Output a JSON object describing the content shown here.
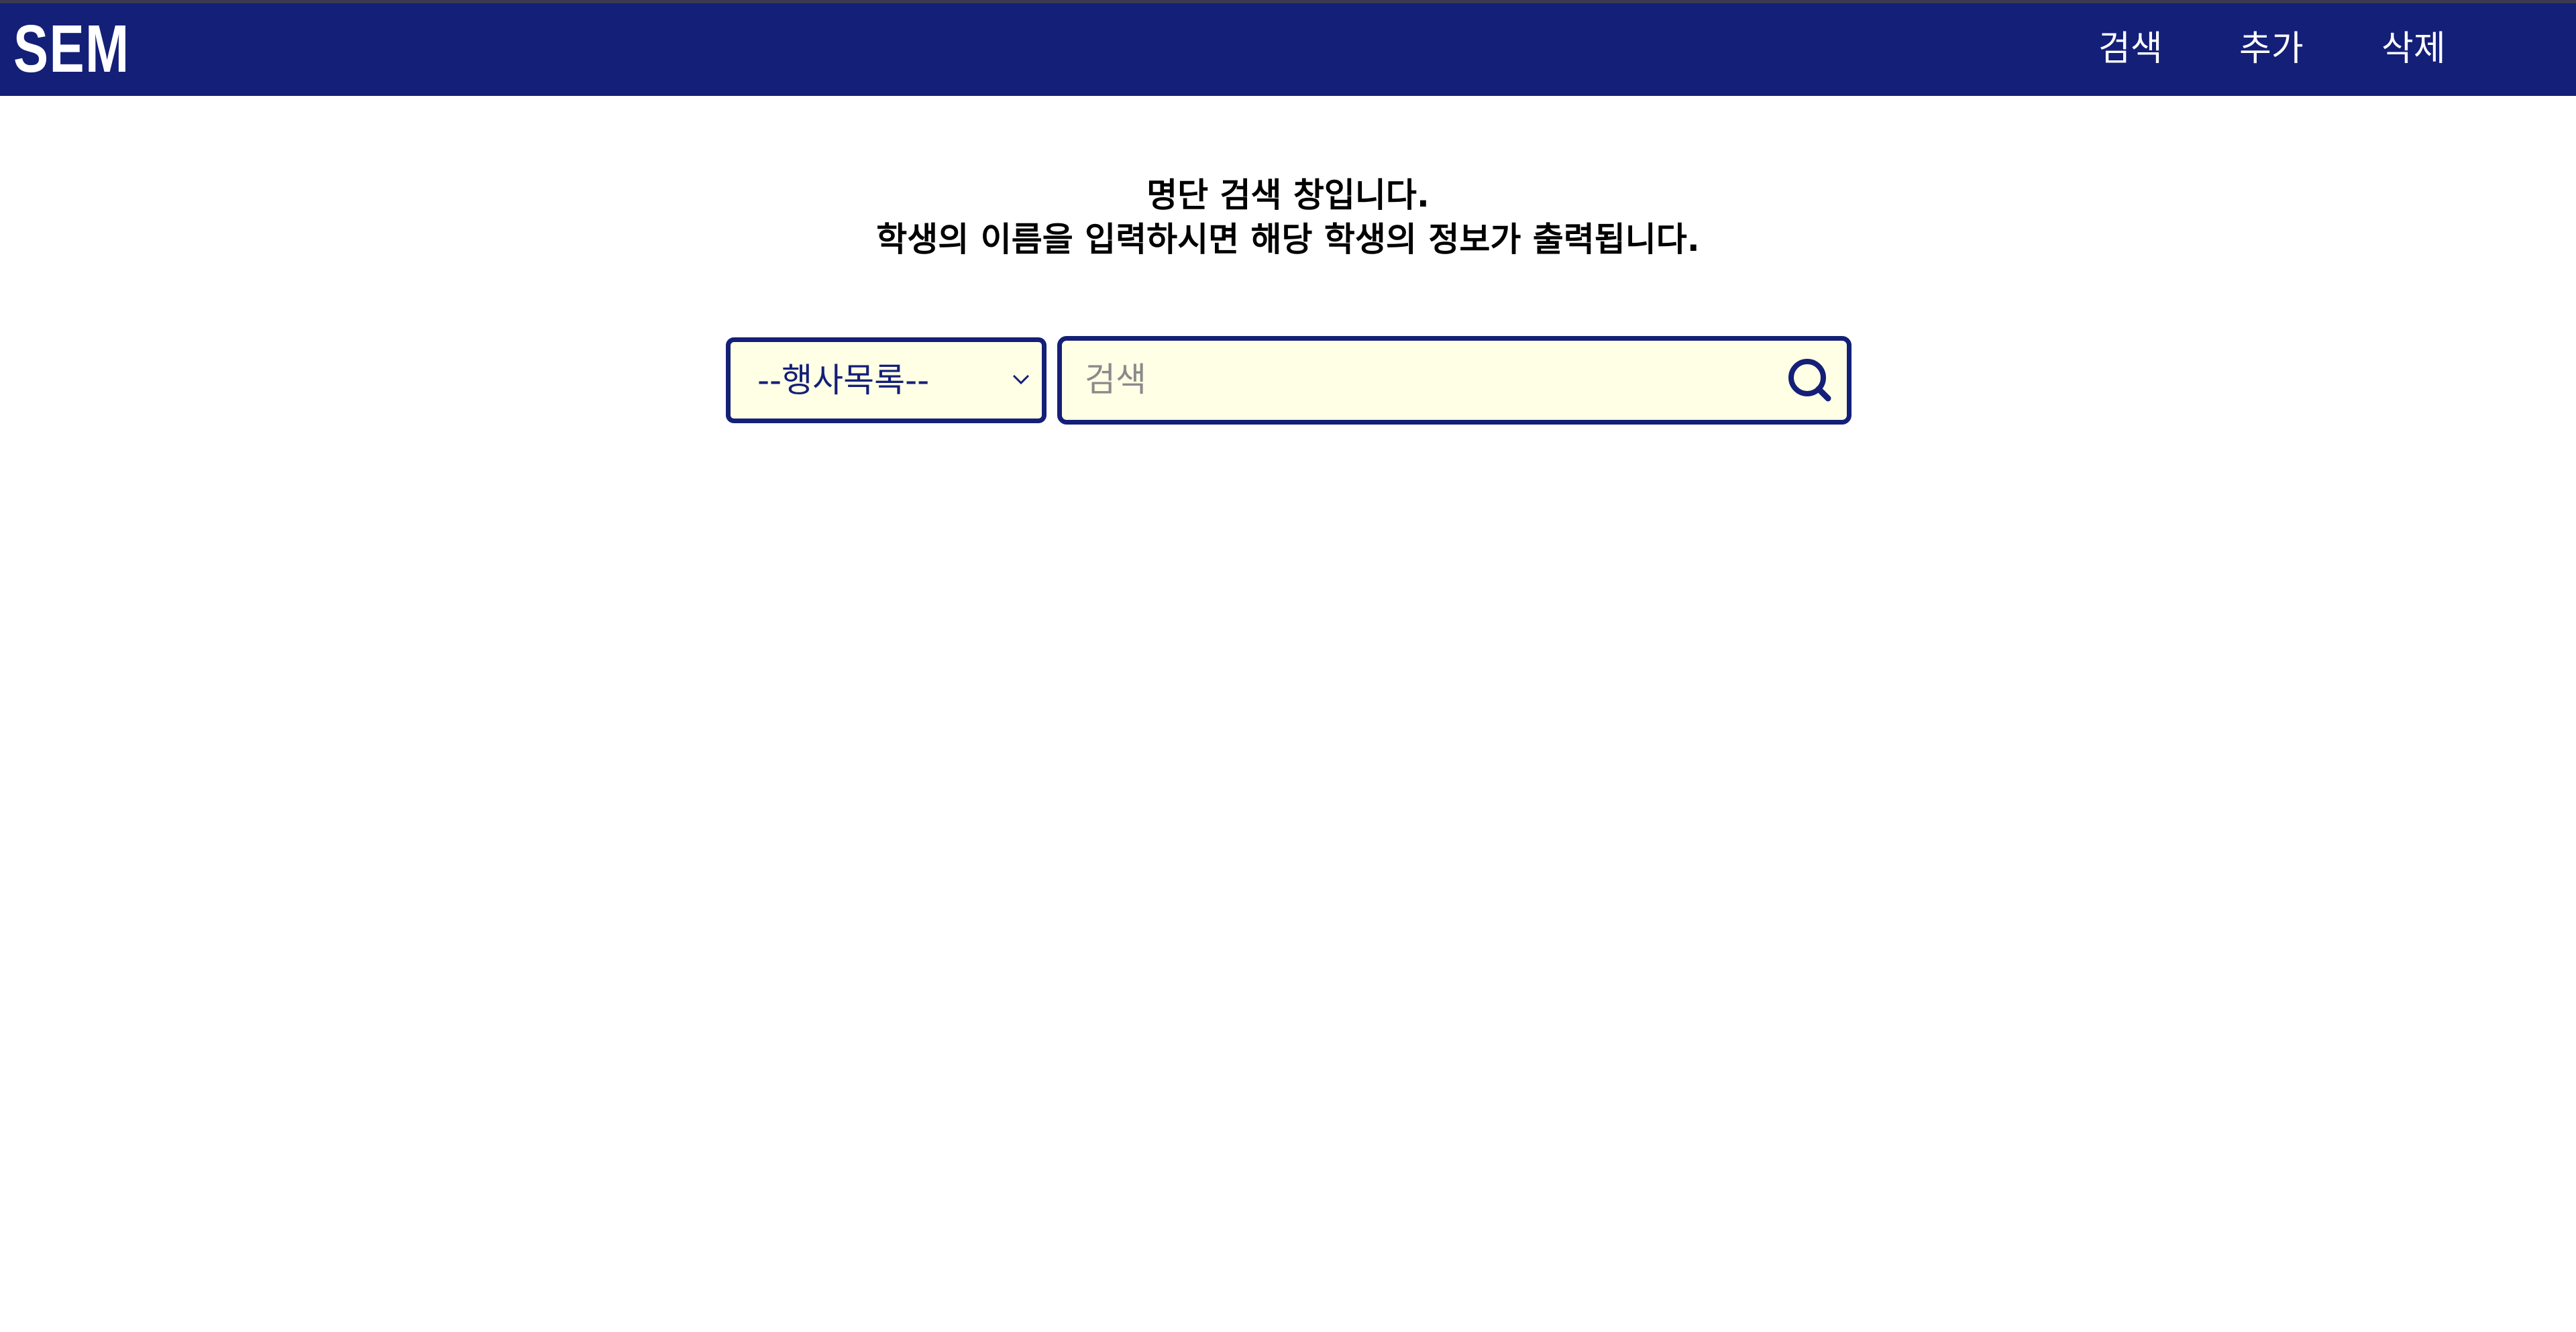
{
  "header": {
    "logo_text": "SEM",
    "nav": {
      "search": "검색",
      "add": "추가",
      "delete": "삭제"
    }
  },
  "intro": {
    "line1": "명단 검색 창입니다.",
    "line2": "학생의 이름을 입력하시면 해당 학생의 정보가 출력됩니다."
  },
  "search_form": {
    "event_select": {
      "selected": "--행사목록--"
    },
    "search_input": {
      "value": "",
      "placeholder": "검색"
    },
    "search_button_icon": "search-icon"
  },
  "colors": {
    "header_bg": "#141f78",
    "field_bg": "#ffffe6",
    "field_border": "#141f78"
  }
}
